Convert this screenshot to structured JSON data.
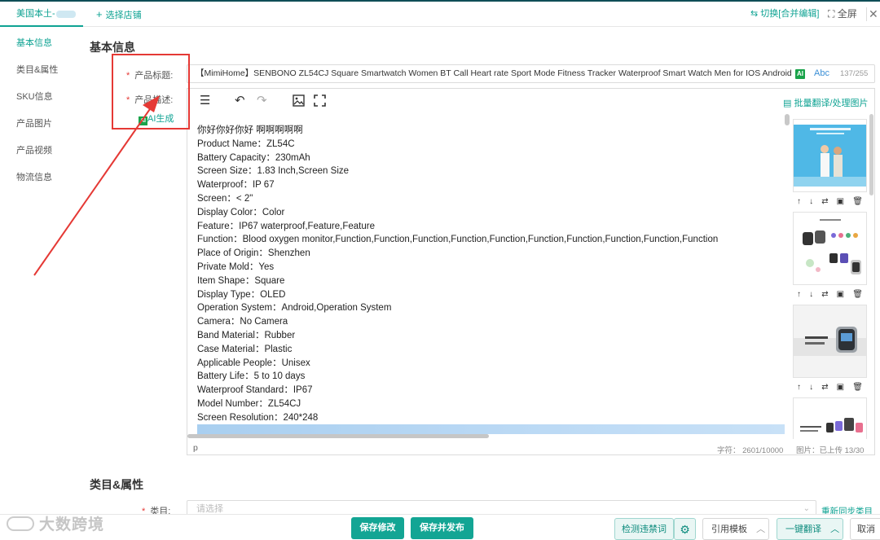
{
  "topbar": {
    "store_tab": "美国本土-",
    "add_store": "选择店铺",
    "switch_edit": "切换[合并编辑]",
    "fullscreen": "全屏"
  },
  "sidebar": {
    "items": [
      {
        "label": "基本信息"
      },
      {
        "label": "类目&属性"
      },
      {
        "label": "SKU信息"
      },
      {
        "label": "产品图片"
      },
      {
        "label": "产品视频"
      },
      {
        "label": "物流信息"
      }
    ]
  },
  "basic_info": {
    "section_title": "基本信息",
    "title_label": "产品标题:",
    "desc_label": "产品描述:",
    "ai_generate": "AI生成",
    "title_value": "【MimiHome】SENBONO ZL54CJ Square Smartwatch Women BT Call Heart rate Sport Mode Fitness Tracker Waterproof Smart Watch Men for IOS Android",
    "title_ai_badge": "AI",
    "title_abc": "Abc",
    "title_count": "137/255"
  },
  "editor": {
    "batch_translate": "批量翻译/处理图片",
    "lines": [
      "你好你好你好 啊啊啊啊啊",
      "Product Name：ZL54C",
      "Battery Capacity：230mAh",
      "Screen Size：1.83 Inch,Screen Size",
      "Waterproof：IP 67",
      "Screen：< 2\"",
      "Display Color：Color",
      "Feature：IP67 waterproof,Feature,Feature",
      "Function：Blood oxygen monitor,Function,Function,Function,Function,Function,Function,Function,Function,Function,Function",
      "Place of Origin：Shenzhen",
      "Private Mold：Yes",
      "Item Shape：Square",
      "Display Type：OLED",
      "Operation System：Android,Operation System",
      "Camera：No Camera",
      "Band Material：Rubber",
      "Case Material：Plastic",
      "Applicable People：Unisex",
      "Battery Life：5 to 10 days",
      "Waterproof Standard：IP67",
      "Model Number：ZL54CJ",
      "Screen Resolution：240*248"
    ],
    "status_tag": "p",
    "char_count": "字符：  2601/10000",
    "image_count": "图片：已上传 13/30"
  },
  "category": {
    "section_title": "类目&属性",
    "label": "类目:",
    "placeholder": "请选择",
    "resync": "重新同步类目"
  },
  "bottom": {
    "save_changes": "保存修改",
    "save_publish": "保存并发布",
    "check_forbidden": "检测违禁词",
    "quote_template": "引用模板",
    "one_click_translate": "一键翻译",
    "cancel": "取消"
  },
  "watermark": "大数跨境",
  "colors": {
    "accent": "#13a594",
    "annotation_red": "#e53935"
  }
}
